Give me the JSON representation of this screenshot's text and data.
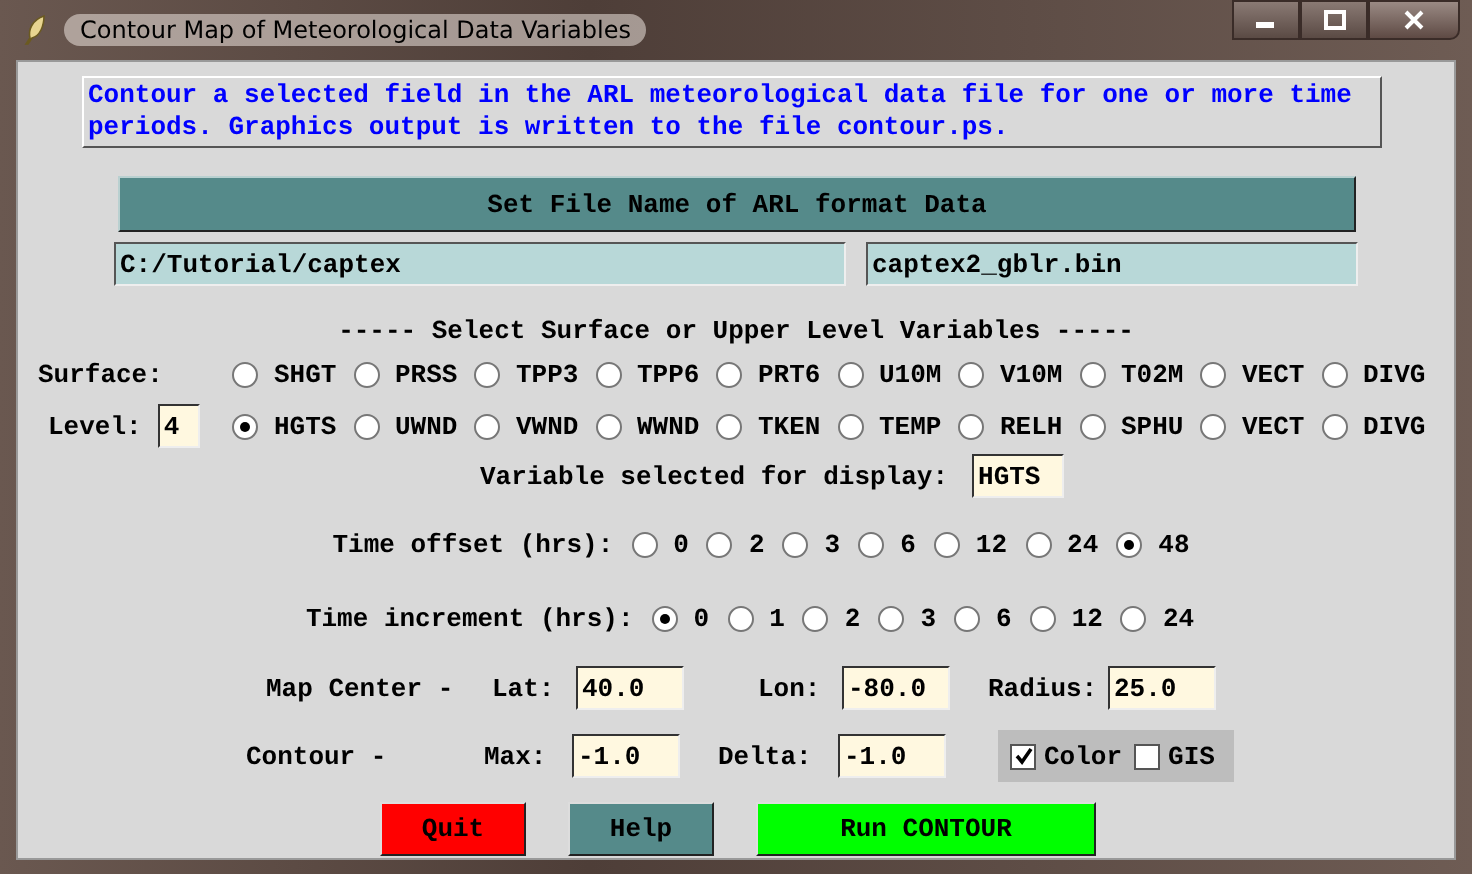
{
  "window": {
    "title": "Contour Map of Meteorological Data Variables"
  },
  "description": "Contour a selected field in the ARL meteorological data file for one or more time periods. Graphics output is written to the file contour.ps.",
  "file_button": "Set File Name of ARL format Data",
  "directory": "C:/Tutorial/captex",
  "file_name": "captex2_gblr.bin",
  "variables_heading": "----- Select Surface or Upper Level Variables -----",
  "surface": {
    "label": "Surface:",
    "options": [
      {
        "label": "SHGT",
        "selected": false
      },
      {
        "label": "PRSS",
        "selected": false
      },
      {
        "label": "TPP3",
        "selected": false
      },
      {
        "label": "TPP6",
        "selected": false
      },
      {
        "label": "PRT6",
        "selected": false
      },
      {
        "label": "U10M",
        "selected": false
      },
      {
        "label": "V10M",
        "selected": false
      },
      {
        "label": "T02M",
        "selected": false
      },
      {
        "label": "VECT",
        "selected": false
      },
      {
        "label": "DIVG",
        "selected": false
      }
    ]
  },
  "level": {
    "label": "Level:",
    "value": "4",
    "options": [
      {
        "label": "HGTS",
        "selected": true
      },
      {
        "label": "UWND",
        "selected": false
      },
      {
        "label": "VWND",
        "selected": false
      },
      {
        "label": "WWND",
        "selected": false
      },
      {
        "label": "TKEN",
        "selected": false
      },
      {
        "label": "TEMP",
        "selected": false
      },
      {
        "label": "RELH",
        "selected": false
      },
      {
        "label": "SPHU",
        "selected": false
      },
      {
        "label": "VECT",
        "selected": false
      },
      {
        "label": "DIVG",
        "selected": false
      }
    ]
  },
  "selected_variable": {
    "label": "Variable selected for display:",
    "value": "HGTS"
  },
  "time_offset": {
    "label": "Time offset (hrs):",
    "options": [
      {
        "label": "0",
        "selected": false
      },
      {
        "label": "2",
        "selected": false
      },
      {
        "label": "3",
        "selected": false
      },
      {
        "label": "6",
        "selected": false
      },
      {
        "label": "12",
        "selected": false
      },
      {
        "label": "24",
        "selected": false
      },
      {
        "label": "48",
        "selected": true
      }
    ]
  },
  "time_increment": {
    "label": "Time increment (hrs):",
    "options": [
      {
        "label": "0",
        "selected": true
      },
      {
        "label": "1",
        "selected": false
      },
      {
        "label": "2",
        "selected": false
      },
      {
        "label": "3",
        "selected": false
      },
      {
        "label": "6",
        "selected": false
      },
      {
        "label": "12",
        "selected": false
      },
      {
        "label": "24",
        "selected": false
      }
    ]
  },
  "map_center": {
    "label": "Map Center -",
    "lat_label": "Lat:",
    "lat": "40.0",
    "lon_label": "Lon:",
    "lon": "-80.0",
    "radius_label": "Radius:",
    "radius": "25.0"
  },
  "contour": {
    "label": "Contour -",
    "max_label": "Max:",
    "max": "-1.0",
    "delta_label": "Delta:",
    "delta": "-1.0"
  },
  "options": [
    {
      "label": "Color",
      "checked": true
    },
    {
      "label": "GIS",
      "checked": false
    }
  ],
  "buttons": [
    {
      "label": "Quit",
      "kind": "quit"
    },
    {
      "label": "Help",
      "kind": "help"
    },
    {
      "label": "Run CONTOUR",
      "kind": "run"
    }
  ]
}
